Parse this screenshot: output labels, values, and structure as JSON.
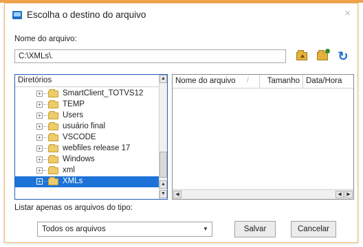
{
  "dialog": {
    "title": "Escolha o destino do arquivo",
    "close_glyph": "×",
    "filename_label": "Nome do arquivo:",
    "path_value": "C:\\XMLs\\."
  },
  "toolbar": {
    "icons": [
      "folder-up-icon",
      "new-folder-icon",
      "refresh-icon"
    ],
    "refresh_glyph": "↻"
  },
  "directories": {
    "header": "Diretórios",
    "items": [
      {
        "label": "SmartClient_TOTVS12",
        "expander": "+"
      },
      {
        "label": "TEMP",
        "expander": "+"
      },
      {
        "label": "Users",
        "expander": "+"
      },
      {
        "label": "usuário final",
        "expander": "+"
      },
      {
        "label": "VSCODE",
        "expander": "+"
      },
      {
        "label": "webfiles release 17",
        "expander": "+"
      },
      {
        "label": "Windows",
        "expander": "+"
      },
      {
        "label": "xml",
        "expander": "+"
      },
      {
        "label": "XMLs",
        "expander": "+",
        "selected": true
      }
    ]
  },
  "files": {
    "columns": [
      "Nome do arquivo",
      "Tamanho",
      "Data/Hora"
    ],
    "sort_glyph": "/"
  },
  "filter": {
    "label": "Listar apenas os arquivos do tipo:",
    "selected": "Todos os arquivos",
    "arrow": "▼"
  },
  "buttons": {
    "save": "Salvar",
    "cancel": "Cancelar"
  },
  "scrollbar_glyphs": {
    "up": "▲",
    "down": "▼",
    "left": "◀",
    "right": "▶"
  },
  "colors": {
    "selection": "#1e73d8",
    "dialog_border": "#f2b56a",
    "refresh": "#1c6fd0"
  }
}
